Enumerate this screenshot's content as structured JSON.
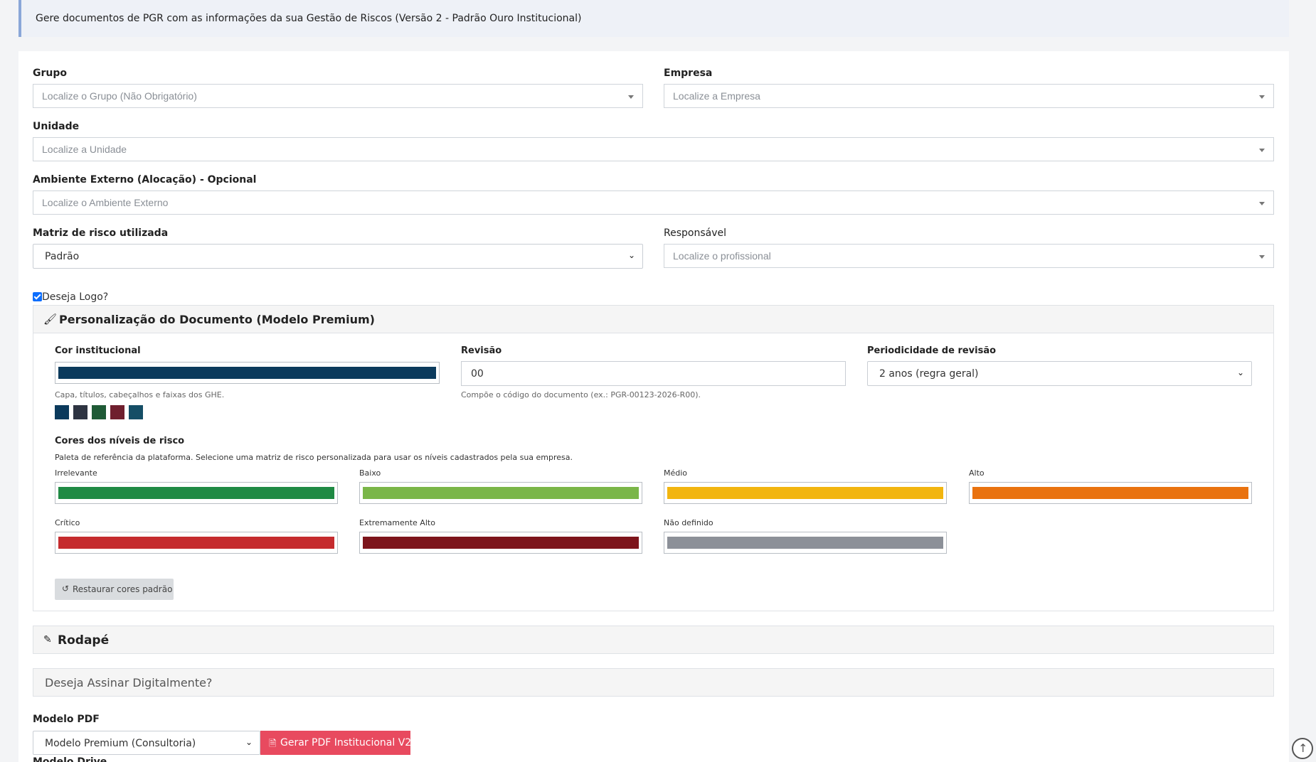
{
  "info": {
    "text": "Gere documentos de PGR com as informações da sua Gestão de Riscos (Versão 2 - Padrão Ouro Institucional)"
  },
  "form": {
    "grupo": {
      "label": "Grupo",
      "placeholder": "Localize o Grupo (Não Obrigatório)"
    },
    "empresa": {
      "label": "Empresa",
      "placeholder": "Localize a Empresa"
    },
    "unidade": {
      "label": "Unidade",
      "placeholder": "Localize a Unidade"
    },
    "ambiente": {
      "label": "Ambiente Externo (Alocação) - Opcional",
      "placeholder": "Localize o Ambiente Externo"
    },
    "matriz": {
      "label": "Matriz de risco utilizada",
      "value": "Padrão"
    },
    "responsavel": {
      "label": "Responsável",
      "placeholder": "Localize o profissional"
    }
  },
  "logo": {
    "label": "Deseja Logo?",
    "checked": true
  },
  "personalizacao": {
    "title": "Personalização do Documento (Modelo Premium)",
    "icon": "brush-icon",
    "cor_institucional": {
      "label": "Cor institucional",
      "value": "#0b3a5c",
      "help": "Capa, títulos, cabeçalhos e faixas dos GHE."
    },
    "presets": [
      "#0b3a5c",
      "#2e3442",
      "#1f5a36",
      "#6f1f2e",
      "#154e66"
    ],
    "revisao": {
      "label": "Revisão",
      "value": "00",
      "help": "Compõe o código do documento (ex.: PGR-00123-2026-R00)."
    },
    "periodicidade": {
      "label": "Periodicidade de revisão",
      "value": "2 anos (regra geral)"
    },
    "niveis": {
      "title": "Cores dos níveis de risco",
      "help": "Paleta de referência da plataforma. Selecione uma matriz de risco personalizada para usar os níveis cadastrados pela sua empresa.",
      "items": [
        {
          "label": "Irrelevante",
          "color": "#1f8a44"
        },
        {
          "label": "Baixo",
          "color": "#7ab648"
        },
        {
          "label": "Médio",
          "color": "#f2b50f"
        },
        {
          "label": "Alto",
          "color": "#e9720f"
        },
        {
          "label": "Crítico",
          "color": "#c52b2e"
        },
        {
          "label": "Extremamente Alto",
          "color": "#7d141b"
        },
        {
          "label": "Não definido",
          "color": "#8c9098"
        }
      ]
    },
    "restore_label": "Restaurar cores padrão"
  },
  "rodape": {
    "title": "Rodapé",
    "icon": "pencil-icon"
  },
  "assinatura": {
    "title": "Deseja Assinar Digitalmente?"
  },
  "modelo_pdf": {
    "label": "Modelo PDF",
    "value": "Modelo Premium (Consultoria)",
    "button_label": "Gerar PDF Institucional V2"
  },
  "modelo_drive": {
    "label": "Modelo Drive"
  }
}
